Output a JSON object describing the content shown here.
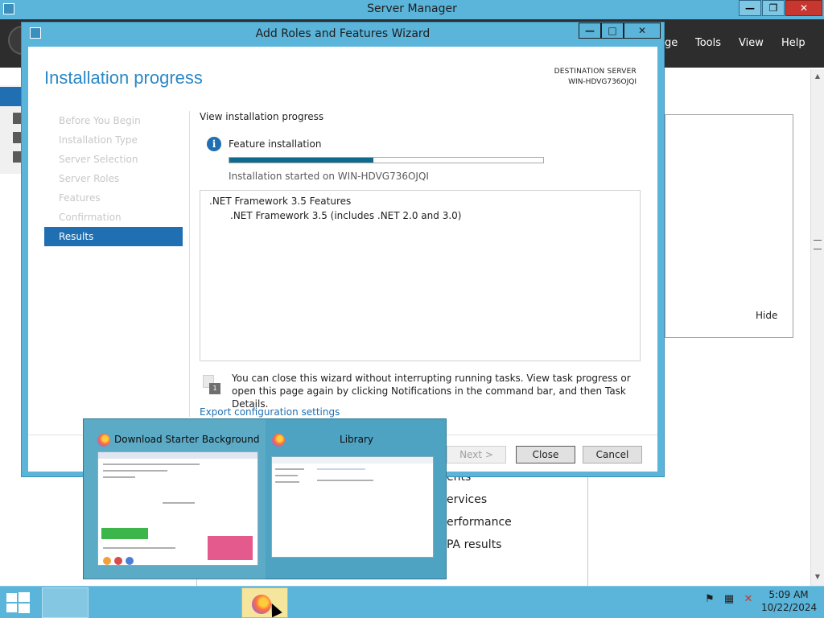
{
  "server_manager": {
    "title": "Server Manager",
    "menu": {
      "partial": "ge",
      "tools": "Tools",
      "view": "View",
      "help": "Help"
    },
    "hide_label": "Hide",
    "tile_items": [
      "ents",
      "ervices",
      "erformance",
      "PA results"
    ]
  },
  "wizard": {
    "title": "Add Roles and Features Wizard",
    "header_title": "Installation progress",
    "destination_label": "DESTINATION SERVER",
    "destination_server": "WIN-HDVG736OJQI",
    "steps": [
      {
        "label": "Before You Begin"
      },
      {
        "label": "Installation Type"
      },
      {
        "label": "Server Selection"
      },
      {
        "label": "Server Roles"
      },
      {
        "label": "Features"
      },
      {
        "label": "Confirmation"
      },
      {
        "label": "Results"
      }
    ],
    "active_step": "Results",
    "view_progress_label": "View installation progress",
    "feature_installation_label": "Feature installation",
    "progress_fraction": 0.46,
    "installation_started": "Installation started on WIN-HDVG736OJQI",
    "results": {
      "parent": ".NET Framework 3.5 Features",
      "child": ".NET Framework 3.5 (includes .NET 2.0 and 3.0)"
    },
    "note": "You can close this wizard without interrupting running tasks. View task progress or open this page again by clicking Notifications in the command bar, and then Task Details.",
    "export_link": "Export configuration settings",
    "buttons": {
      "next": "Next >",
      "close": "Close",
      "cancel": "Cancel"
    }
  },
  "thumbnails": [
    {
      "title": "Download Starter Background C...",
      "icon": "firefox-icon"
    },
    {
      "title": "Library",
      "icon": "firefox-icon"
    }
  ],
  "taskbar": {
    "items": [
      "start-button",
      "server-manager",
      "powershell",
      "file-explorer",
      "setup-tool",
      "firefox"
    ],
    "time": "5:09 AM",
    "date": "10/22/2024"
  },
  "colors": {
    "accent": "#1f6fb2",
    "title_blue": "#2b88c8",
    "chrome": "#5bb4d9",
    "progress": "#0f6b8d"
  }
}
